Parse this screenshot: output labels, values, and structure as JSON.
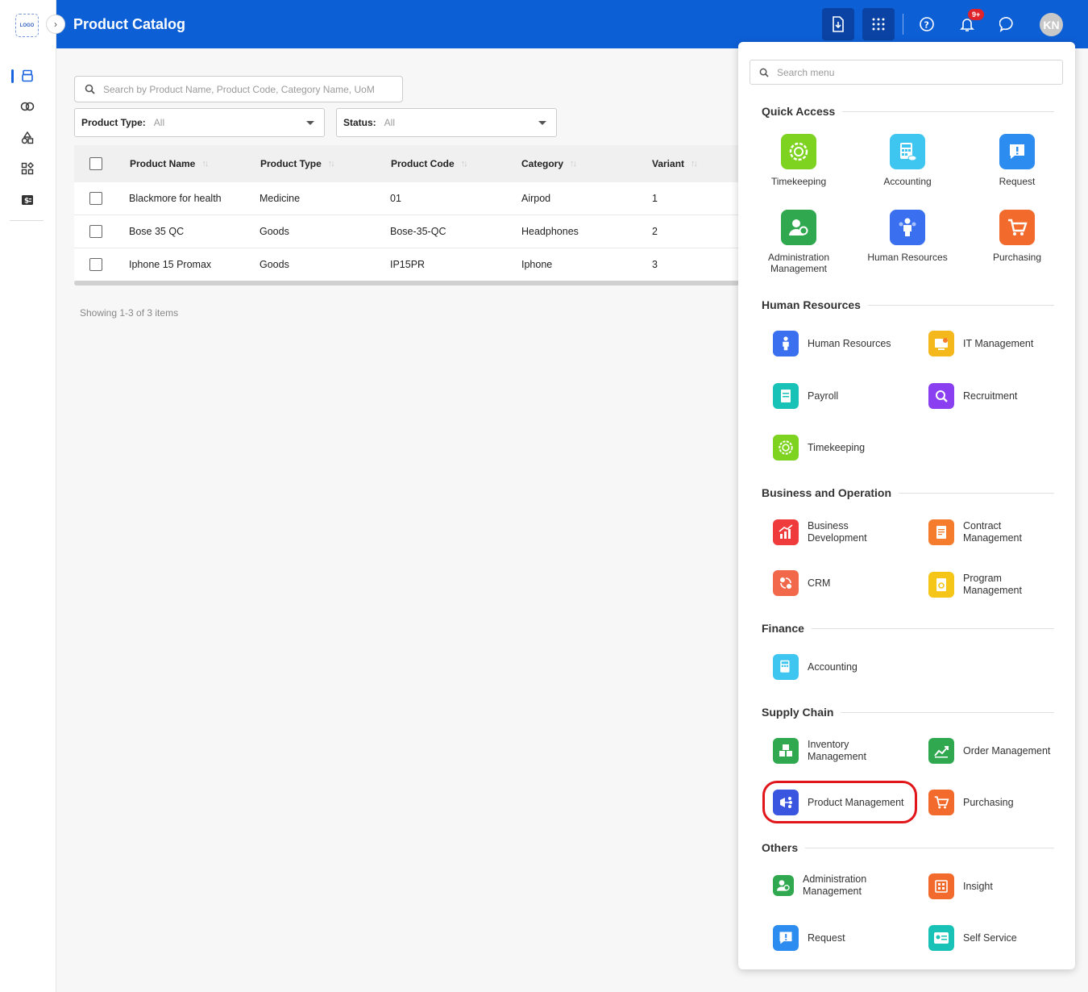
{
  "app": {
    "logo_text": "LOGO",
    "page_title": "Product Catalog",
    "notification_badge": "9+",
    "avatar_initials": "KN"
  },
  "search": {
    "placeholder": "Search by Product Name, Product Code, Category Name, UoM"
  },
  "filters": {
    "product_type": {
      "label": "Product Type:",
      "value": "All"
    },
    "status": {
      "label": "Status:",
      "value": "All"
    }
  },
  "table": {
    "columns": [
      "Product Name",
      "Product Type",
      "Product Code",
      "Category",
      "Variant"
    ],
    "rows": [
      [
        "Blackmore for health",
        "Medicine",
        "01",
        "Airpod",
        "1"
      ],
      [
        "Bose 35 QC",
        "Goods",
        "Bose-35-QC",
        "Headphones",
        "2"
      ],
      [
        "Iphone 15 Promax",
        "Goods",
        "IP15PR",
        "Iphone",
        "3"
      ]
    ],
    "footer": "Showing 1-3 of 3 items"
  },
  "menu": {
    "search_placeholder": "Search menu",
    "quick_access": {
      "title": "Quick Access",
      "items": [
        {
          "label": "Timekeeping",
          "color": "#7ed321"
        },
        {
          "label": "Accounting",
          "color": "#3ec6f0"
        },
        {
          "label": "Request",
          "color": "#2d8cf0"
        },
        {
          "label": "Administration Management",
          "color": "#2fa84f"
        },
        {
          "label": "Human Resources",
          "color": "#3a6ff0"
        },
        {
          "label": "Purchasing",
          "color": "#f26b2c"
        }
      ]
    },
    "human_resources": {
      "title": "Human Resources",
      "items": [
        {
          "label": "Human Resources",
          "color": "#3a6ff0"
        },
        {
          "label": "IT Management",
          "color": "#f5b81c"
        },
        {
          "label": "Payroll",
          "color": "#19c2b6"
        },
        {
          "label": "Recruitment",
          "color": "#8a3ff0"
        },
        {
          "label": "Timekeeping",
          "color": "#7ed321"
        }
      ]
    },
    "business": {
      "title": "Business and Operation",
      "items": [
        {
          "label": "Business Development",
          "color": "#ef3b3b"
        },
        {
          "label": "Contract Management",
          "color": "#f57c2c"
        },
        {
          "label": "CRM",
          "color": "#f2684a"
        },
        {
          "label": "Program Management",
          "color": "#f5c518"
        }
      ]
    },
    "finance": {
      "title": "Finance",
      "items": [
        {
          "label": "Accounting",
          "color": "#3ec6f0"
        }
      ]
    },
    "supply_chain": {
      "title": "Supply Chain",
      "items": [
        {
          "label": "Inventory Management",
          "color": "#2fa84f"
        },
        {
          "label": "Order Management",
          "color": "#2fa84f"
        },
        {
          "label": "Product Management",
          "color": "#3a55e0"
        },
        {
          "label": "Purchasing",
          "color": "#f26b2c"
        }
      ]
    },
    "others": {
      "title": "Others",
      "items": [
        {
          "label": "Administration Management",
          "color": "#2fa84f"
        },
        {
          "label": "Insight",
          "color": "#f26b2c"
        },
        {
          "label": "Request",
          "color": "#2d8cf0"
        },
        {
          "label": "Self Service",
          "color": "#19c2b6"
        }
      ]
    }
  }
}
